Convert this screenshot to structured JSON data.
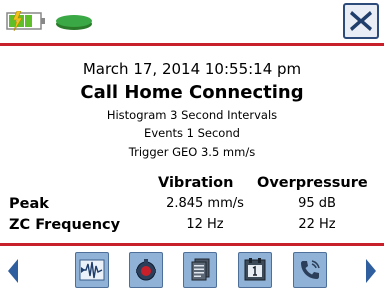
{
  "header": {
    "battery_icon": "battery-charging-icon",
    "disc_icon": "green-disc-icon",
    "close_icon": "close-x-icon"
  },
  "event": {
    "datetime": "March 17, 2014 10:55:14 pm",
    "status": "Call Home Connecting",
    "line1": "Histogram 3 Second Intervals",
    "line2": "Events 1 Second",
    "line3": "Trigger GEO 3.5 mm/s"
  },
  "table": {
    "headers": [
      "Vibration",
      "Overpressure"
    ],
    "rows": [
      {
        "label": "Peak",
        "vibration": "2.845 mm/s",
        "overpressure": "95 dB"
      },
      {
        "label": "ZC Frequency",
        "vibration": "12 Hz",
        "overpressure": "22 Hz"
      }
    ]
  },
  "toolbar": {
    "buttons": [
      "waveform-icon",
      "sensor-icon",
      "documents-icon",
      "calendar-icon",
      "phone-icon"
    ]
  },
  "colors": {
    "accent_red": "#c8202a",
    "button_blue": "#8fb2d6",
    "arrow_blue": "#2f5f9e"
  }
}
